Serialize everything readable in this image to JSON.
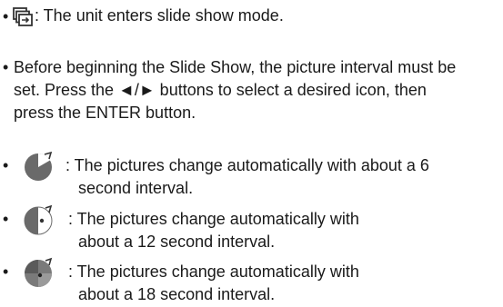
{
  "items": [
    {
      "icon": "slideshow-icon",
      "lines": [
        ": The unit enters slide show mode."
      ]
    },
    {
      "icon": null,
      "lines": [
        "Before beginning the Slide Show, the picture interval must be",
        "set. Press the ◄/► buttons to select a desired icon, then",
        "press the ENTER button."
      ]
    },
    {
      "icon": "interval-6s-icon",
      "lines": [
        ": The pictures change automatically with about a 6",
        "second interval."
      ]
    },
    {
      "icon": "interval-12s-icon",
      "lines": [
        ": The pictures change automatically with",
        "about a 12 second interval."
      ]
    },
    {
      "icon": "interval-18s-icon",
      "lines": [
        ": The pictures change automatically with",
        "about a 18 second interval."
      ]
    }
  ],
  "bullet_char": "•"
}
